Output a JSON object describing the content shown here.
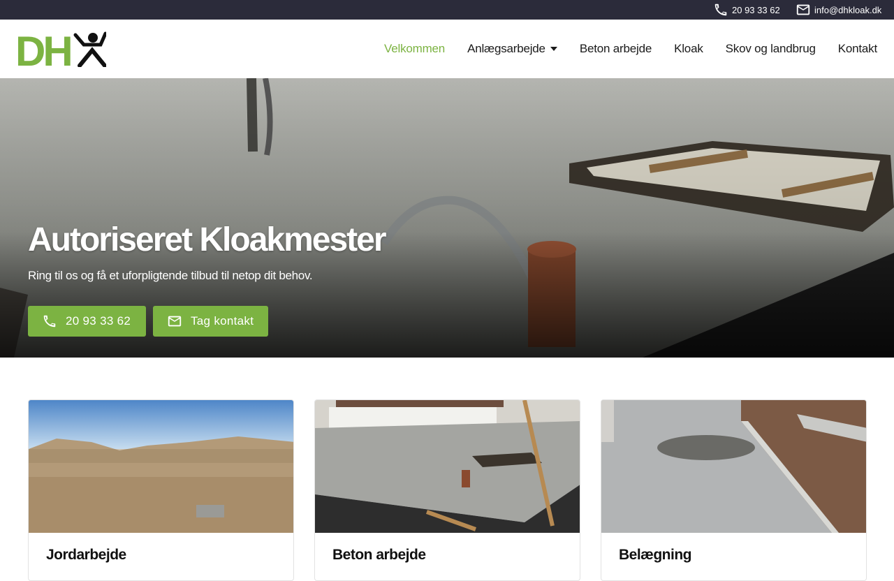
{
  "topbar": {
    "phone": "20 93 33 62",
    "email": "info@dhkloak.dk"
  },
  "header": {
    "logo_text": "DH",
    "nav": [
      {
        "label": "Velkommen",
        "active": true
      },
      {
        "label": "Anlægsarbejde",
        "has_dropdown": true
      },
      {
        "label": "Beton arbejde"
      },
      {
        "label": "Kloak"
      },
      {
        "label": "Skov og landbrug"
      },
      {
        "label": "Kontakt"
      }
    ]
  },
  "hero": {
    "title": "Autoriseret Kloakmester",
    "subtitle": "Ring til os og få et uforpligtende tilbud til netop dit behov.",
    "phone_button": "20 93 33 62",
    "contact_button": "Tag kontakt"
  },
  "cards": [
    {
      "title": "Jordarbejde",
      "image": "dirt-field-photo"
    },
    {
      "title": "Beton arbejde",
      "image": "concrete-slab-photo"
    },
    {
      "title": "Belægning",
      "image": "paving-stones-photo"
    }
  ],
  "colors": {
    "accent": "#7cb342",
    "topbar": "#2b2b3a",
    "text": "#1a1a1a"
  },
  "icons": {
    "phone": "phone-icon",
    "mail": "mail-icon",
    "caret": "caret-down-icon"
  }
}
